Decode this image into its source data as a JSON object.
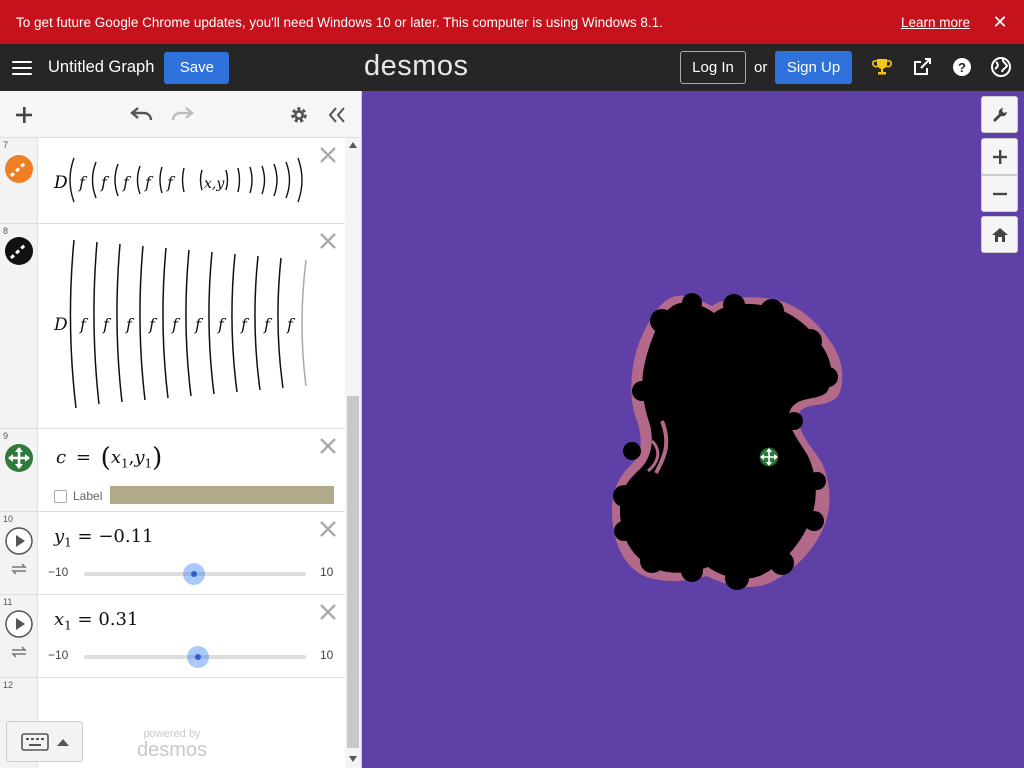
{
  "banner": {
    "message": "To get future Google Chrome updates, you'll need Windows 10 or later. This computer is using Windows 8.1.",
    "learn_more": "Learn more",
    "close": "✕"
  },
  "header": {
    "title": "Untitled Graph",
    "save": "Save",
    "brand": "desmos",
    "login": "Log In",
    "or": "or",
    "signup": "Sign Up"
  },
  "expressions": {
    "e7": {
      "num": "7",
      "color": "#f07f24",
      "latex": "D(f(f(f(f(f((x,y)))))))"
    },
    "e8": {
      "num": "8",
      "color": "#000000",
      "latex": "D(f(f(f(f(f(f(f(f(f(f(…))))))))))"
    },
    "e9": {
      "num": "9",
      "color": "#2d7a3a",
      "latex_c": "c",
      "latex_eq": "=",
      "x": "x",
      "xsub": "1",
      "y": "y",
      "ysub": "1",
      "label": "Label"
    },
    "e10": {
      "num": "10",
      "var": "y",
      "sub": "1",
      "eq": "= −0.11",
      "min": "−10",
      "max": "10",
      "value": -0.11
    },
    "e11": {
      "num": "11",
      "var": "x",
      "sub": "1",
      "eq": "= 0.31",
      "min": "−10",
      "max": "10",
      "value": 0.31
    },
    "e12": {
      "num": "12"
    }
  },
  "footer": {
    "powered_by": "powered by",
    "brand": "desmos"
  },
  "colors": {
    "banner": "#c5121c",
    "header": "#262626",
    "accent": "#2f72dc",
    "graph_bg": "#5f40a6",
    "fractal": "#000000",
    "fractal_edge": "#b36a8a"
  },
  "icons": [
    "hamburger-icon",
    "trophy-icon",
    "share-icon",
    "help-icon",
    "globe-icon",
    "plus-icon",
    "undo-icon",
    "redo-icon",
    "gear-icon",
    "collapse-icon",
    "wrench-icon",
    "zoom-in-icon",
    "zoom-out-icon",
    "home-icon",
    "keyboard-icon",
    "play-icon",
    "loop-icon",
    "close-icon"
  ]
}
